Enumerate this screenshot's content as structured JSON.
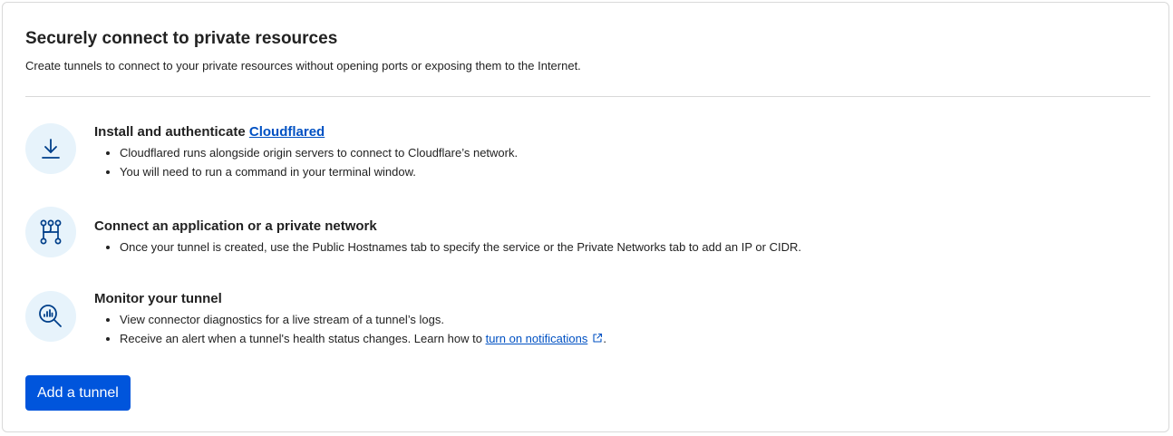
{
  "header": {
    "title": "Securely connect to private resources",
    "subtitle": "Create tunnels to connect to your private resources without opening ports or exposing them to the Internet."
  },
  "steps": [
    {
      "icon": "download-icon",
      "heading": "Install and authenticate ",
      "heading_link": "Cloudflared",
      "bullets": [
        "Cloudflared runs alongside origin servers to connect to Cloudflare’s network.",
        "You will need to run a command in your terminal window."
      ]
    },
    {
      "icon": "network-branch-icon",
      "heading": "Connect an application or a private network",
      "bullets": [
        "Once your tunnel is created, use the Public Hostnames tab to specify the service or the Private Networks tab to add an IP or CIDR."
      ]
    },
    {
      "icon": "monitor-search-icon",
      "heading": "Monitor your tunnel",
      "bullets": [
        "View connector diagnostics for a live stream of a tunnel’s logs."
      ],
      "alert_bullet": {
        "prefix": "Receive an alert when a tunnel's health status changes. Learn how to ",
        "link": "turn on notifications",
        "suffix": "."
      }
    }
  ],
  "actions": {
    "add_tunnel_label": "Add a tunnel"
  },
  "colors": {
    "accent": "#0055dc",
    "link": "#0051c3",
    "icon_bg": "#e7f3fb",
    "icon_stroke": "#003f8a"
  }
}
